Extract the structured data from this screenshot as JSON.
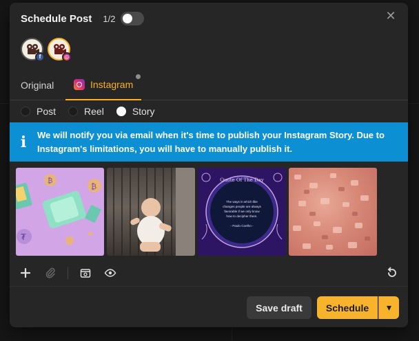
{
  "modal": {
    "title": "Schedule Post",
    "step": "1/2",
    "close_icon": "close-icon",
    "accent_color": "#f7b32b",
    "info_color": "#0d8fd4"
  },
  "accounts": [
    {
      "icon": "film-camera-avatar",
      "network": "facebook",
      "badge": "f",
      "selected": false
    },
    {
      "icon": "film-camera-avatar",
      "network": "instagram",
      "badge": "◎",
      "selected": true
    }
  ],
  "tabs": [
    {
      "label": "Original",
      "active": false
    },
    {
      "label": "Instagram",
      "active": true
    }
  ],
  "post_types": [
    {
      "label": "Post",
      "selected": false
    },
    {
      "label": "Reel",
      "selected": false
    },
    {
      "label": "Story",
      "selected": true
    }
  ],
  "info": {
    "icon": "i",
    "text": "We will notify you via email when it's time to publish your Instagram Story. Due to Instagram's limitations, you will have to manually publish it."
  },
  "media": [
    {
      "name": "wallet-coins-image"
    },
    {
      "name": "baby-image"
    },
    {
      "name": "quote-image",
      "heading": "Quote Of The Day",
      "quote": "The ways in which like changes people are always favorable if we only know how to decipher them.",
      "author": "- Paulo Coelho -"
    },
    {
      "name": "pink-salt-image"
    }
  ],
  "toolbar": {
    "icons": [
      "plus-icon",
      "attachment-icon",
      "media-library-icon",
      "preview-eye-icon",
      "undo-icon"
    ]
  },
  "footer": {
    "save_draft": "Save draft",
    "schedule": "Schedule",
    "caret": "▾"
  }
}
